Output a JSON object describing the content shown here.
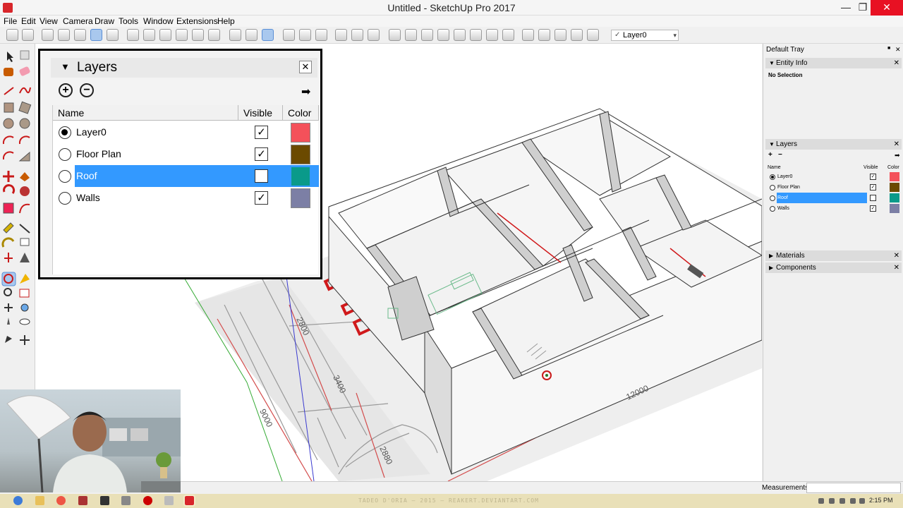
{
  "window": {
    "title": "Untitled - SketchUp Pro 2017",
    "minimize": "—",
    "maximize": "❐",
    "close": "✕"
  },
  "menu": [
    "File",
    "Edit",
    "View",
    "Camera",
    "Draw",
    "Tools",
    "Window",
    "Extensions",
    "Help"
  ],
  "toolbar": {
    "layer_dropdown": "Layer0",
    "layer_check": "✓",
    "dropdown_arrow": "▾"
  },
  "layers_dialog": {
    "title": "Layers",
    "collapse_glyph": "▼",
    "close_glyph": "✕",
    "add_glyph": "+",
    "remove_glyph": "−",
    "details_glyph": "➡",
    "columns": {
      "name": "Name",
      "visible": "Visible",
      "color": "Color"
    },
    "rows": [
      {
        "name": "Layer0",
        "active": true,
        "visible": true,
        "selected": false,
        "color": "#f4515a"
      },
      {
        "name": "Floor Plan",
        "active": false,
        "visible": true,
        "selected": false,
        "color": "#6b4a00"
      },
      {
        "name": "Roof",
        "active": false,
        "visible": false,
        "selected": true,
        "color": "#0a9a8a"
      },
      {
        "name": "Walls",
        "active": false,
        "visible": true,
        "selected": false,
        "color": "#7c7fa5"
      }
    ],
    "check_glyph": "✓"
  },
  "tray": {
    "title": "Default Tray",
    "pin_glyph": "■",
    "entity_info": {
      "title": "Entity Info",
      "selection": "No Selection"
    },
    "layers": {
      "title": "Layers",
      "name_col": "Name",
      "visible_col": "Visible",
      "color_col": "Color"
    },
    "materials": {
      "title": "Materials"
    },
    "components": {
      "title": "Components"
    },
    "expanded_glyph": "▼",
    "collapsed_glyph": "▶",
    "close_glyph": "✕"
  },
  "drawing": {
    "dimensions": [
      "2800",
      "3400",
      "9000",
      "2880",
      "12000"
    ]
  },
  "status": {
    "measurements_label": "Measurements"
  },
  "taskbar": {
    "clock": "2:15 PM",
    "watermark": "TADEO D'ORIA — 2015 — REAKERT.DEVIANTART.COM"
  }
}
